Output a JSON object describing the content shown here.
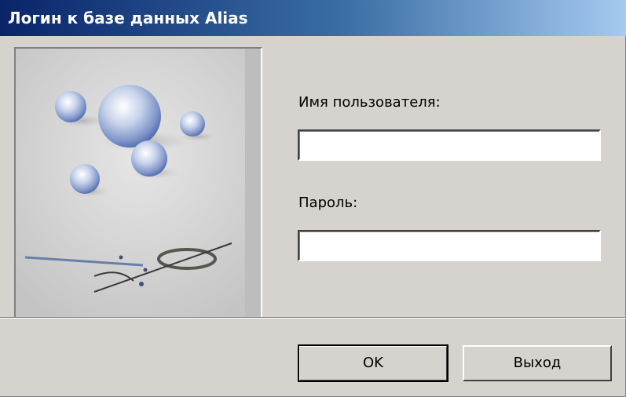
{
  "window": {
    "title": "Логин к базе данных Alias"
  },
  "form": {
    "username_label": "Имя пользователя:",
    "username_value": "",
    "password_label": "Пароль:",
    "password_value": ""
  },
  "buttons": {
    "ok_label": "OK",
    "exit_label": "Выход"
  }
}
